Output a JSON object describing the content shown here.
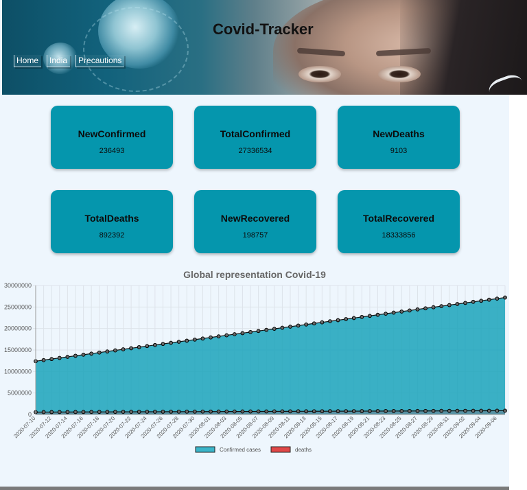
{
  "header": {
    "title": "Covid-Tracker",
    "nav": [
      "Home",
      "India",
      "Precautions"
    ]
  },
  "stats": [
    {
      "label": "NewConfirmed",
      "value": "236493"
    },
    {
      "label": "TotalConfirmed",
      "value": "27336534"
    },
    {
      "label": "NewDeaths",
      "value": "9103"
    },
    {
      "label": "TotalDeaths",
      "value": "892392"
    },
    {
      "label": "NewRecovered",
      "value": "198757"
    },
    {
      "label": "TotalRecovered",
      "value": "18333856"
    }
  ],
  "colors": {
    "card": "#0596ad",
    "confirmed_fill": "#3bb5c9",
    "deaths_fill": "#e04848",
    "page_bg": "#eef6fd"
  },
  "chart_data": {
    "type": "area",
    "title": "Global representation Covid-19",
    "x": [
      "2020-07-10",
      "2020-07-11",
      "2020-07-12",
      "2020-07-13",
      "2020-07-14",
      "2020-07-15",
      "2020-07-16",
      "2020-07-17",
      "2020-07-18",
      "2020-07-19",
      "2020-07-20",
      "2020-07-21",
      "2020-07-22",
      "2020-07-23",
      "2020-07-24",
      "2020-07-25",
      "2020-07-26",
      "2020-07-27",
      "2020-07-28",
      "2020-07-29",
      "2020-07-30",
      "2020-07-31",
      "2020-08-01",
      "2020-08-02",
      "2020-08-03",
      "2020-08-04",
      "2020-08-05",
      "2020-08-06",
      "2020-08-07",
      "2020-08-08",
      "2020-08-09",
      "2020-08-10",
      "2020-08-11",
      "2020-08-12",
      "2020-08-13",
      "2020-08-14",
      "2020-08-15",
      "2020-08-16",
      "2020-08-17",
      "2020-08-18",
      "2020-08-19",
      "2020-08-20",
      "2020-08-21",
      "2020-08-22",
      "2020-08-23",
      "2020-08-24",
      "2020-08-25",
      "2020-08-26",
      "2020-08-27",
      "2020-08-28",
      "2020-08-29",
      "2020-08-30",
      "2020-08-31",
      "2020-09-01",
      "2020-09-02",
      "2020-09-03",
      "2020-09-04",
      "2020-09-05",
      "2020-09-06",
      "2020-09-07"
    ],
    "tick_labels": [
      "2020-07-10",
      "2020-07-12",
      "2020-07-14",
      "2020-07-16",
      "2020-07-18",
      "2020-07-20",
      "2020-07-22",
      "2020-07-24",
      "2020-07-26",
      "2020-07-28",
      "2020-07-30",
      "2020-08-01",
      "2020-08-03",
      "2020-08-05",
      "2020-08-07",
      "2020-08-09",
      "2020-08-11",
      "2020-08-13",
      "2020-08-15",
      "2020-08-17",
      "2020-08-19",
      "2020-08-21",
      "2020-08-23",
      "2020-08-25",
      "2020-08-27",
      "2020-08-29",
      "2020-08-31",
      "2020-09-02",
      "2020-09-04",
      "2020-09-06"
    ],
    "y_ticks": [
      0,
      5000000,
      10000000,
      15000000,
      20000000,
      25000000,
      30000000
    ],
    "ylim": [
      0,
      30000000
    ],
    "series": [
      {
        "name": "Confirmed cases",
        "start": 12400000,
        "end": 27200000
      },
      {
        "name": "deaths",
        "start": 560000,
        "end": 890000
      }
    ],
    "legend_position": "bottom",
    "grid": true
  }
}
